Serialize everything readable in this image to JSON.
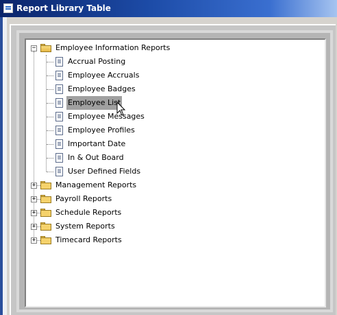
{
  "window": {
    "title": "Report Library Table"
  },
  "tree": {
    "root": {
      "label": "Employee Information Reports",
      "expanded": true
    },
    "children": [
      {
        "label": "Accrual Posting"
      },
      {
        "label": "Employee Accruals"
      },
      {
        "label": "Employee Badges"
      },
      {
        "label": "Employee List",
        "selected": true
      },
      {
        "label": "Employee Messages"
      },
      {
        "label": "Employee Profiles"
      },
      {
        "label": "Important Date"
      },
      {
        "label": "In & Out Board"
      },
      {
        "label": "User Defined Fields"
      }
    ],
    "collapsed_folders": [
      {
        "label": "Management Reports"
      },
      {
        "label": "Payroll Reports"
      },
      {
        "label": "Schedule Reports"
      },
      {
        "label": "System Reports"
      },
      {
        "label": "Timecard Reports"
      }
    ],
    "expander_open_glyph": "−",
    "expander_closed_glyph": "+"
  },
  "colors": {
    "titlebar_start": "#0a246a",
    "selection": "#a0a0a0",
    "folder": "#f5d26b"
  }
}
